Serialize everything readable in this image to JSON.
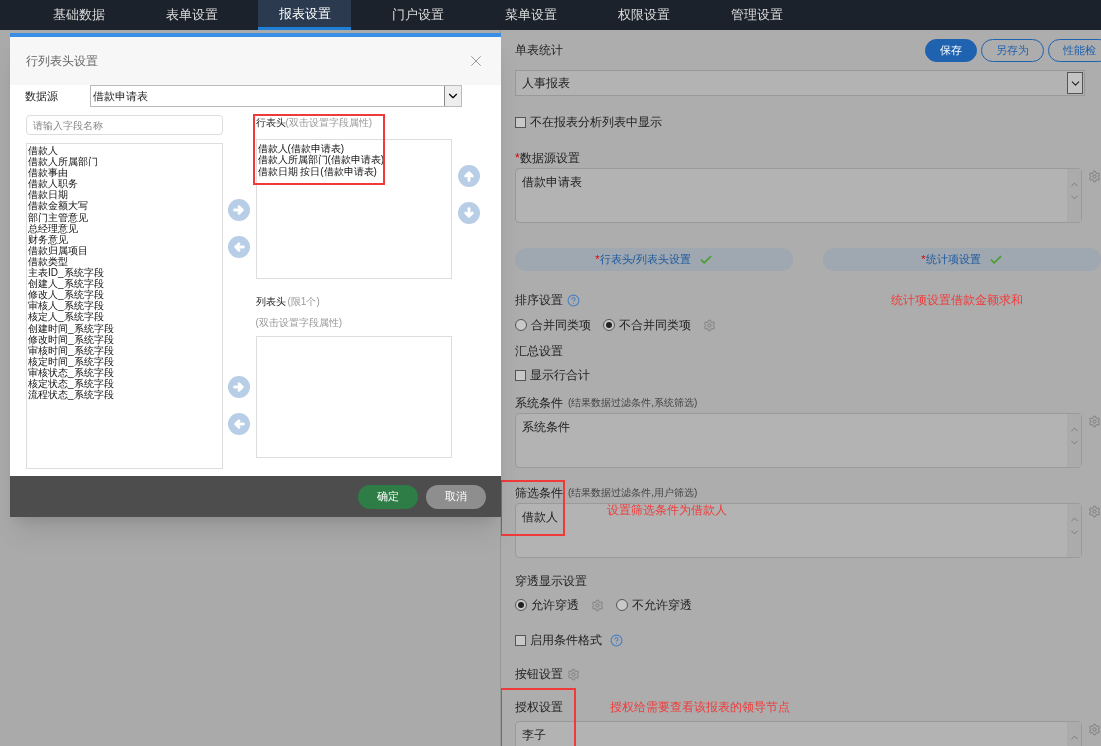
{
  "nav": {
    "tabs": [
      {
        "label": "基础数据",
        "selected": false
      },
      {
        "label": "表单设置",
        "selected": false
      },
      {
        "label": "报表设置",
        "selected": true
      },
      {
        "label": "门户设置",
        "selected": false
      },
      {
        "label": "菜单设置",
        "selected": false
      },
      {
        "label": "权限设置",
        "selected": false
      },
      {
        "label": "管理设置",
        "selected": false
      }
    ]
  },
  "dialog": {
    "title": "行列表头设置",
    "datasource": {
      "label": "数据源",
      "value": "借款申请表"
    },
    "search": {
      "placeholder": "请输入字段名称"
    },
    "fields": [
      "借款人",
      "借款人所属部门",
      "借款事由",
      "借款人职务",
      "借款日期",
      "借款金额大写",
      "部门主管意见",
      "总经理意见",
      "财务意见",
      "借款归属项目",
      "借款类型",
      "主表ID_系统字段",
      "创建人_系统字段",
      "修改人_系统字段",
      "审核人_系统字段",
      "核定人_系统字段",
      "创建时间_系统字段",
      "修改时间_系统字段",
      "审核时间_系统字段",
      "核定时间_系统字段",
      "审核状态_系统字段",
      "核定状态_系统字段",
      "流程状态_系统字段"
    ],
    "row_header": {
      "label": "行表头",
      "hint": "(双击设置字段属性)",
      "items": [
        "借款人(借款申请表)",
        "借款人所属部门(借款申请表)",
        "借款日期 按日(借款申请表)"
      ]
    },
    "column_header": {
      "label": "列表头",
      "limit": "(限1个)",
      "hint": "(双击设置字段属性)"
    },
    "confirm": "确定",
    "cancel": "取消"
  },
  "panel": {
    "title": "单表统计",
    "buttons": [
      {
        "label": "保存",
        "kind": "primary"
      },
      {
        "label": "另存为",
        "kind": "outline"
      },
      {
        "label": "性能检",
        "kind": "outline"
      }
    ],
    "report_type": "人事报表",
    "hide_in_list": {
      "label": "不在报表分析列表中显示",
      "checked": false
    },
    "datasource_setting": {
      "label": "数据源设置",
      "required_mark": "*",
      "value": "借款申请表"
    },
    "setup_buttons": [
      {
        "label": "行表头/列表头设置",
        "required_mark": "*",
        "done": true
      },
      {
        "label": "统计项设置",
        "required_mark": "*",
        "done": true
      }
    ],
    "sort": {
      "label": "排序设置",
      "options": [
        {
          "label": "合并同类项",
          "selected": false
        },
        {
          "label": "不合并同类项",
          "selected": true
        }
      ]
    },
    "summary": {
      "label": "汇总设置",
      "checkbox": {
        "label": "显示行合计",
        "checked": false
      }
    },
    "system_condition": {
      "label": "系统条件",
      "hint": "(结果数据过滤条件,系统筛选)",
      "value": "系统条件"
    },
    "filter_condition": {
      "label": "筛选条件",
      "hint": "(结果数据过滤条件,用户筛选)",
      "value": "借款人"
    },
    "drill": {
      "label": "穿透显示设置",
      "options": [
        {
          "label": "允许穿透",
          "selected": true
        },
        {
          "label": "不允许穿透",
          "selected": false
        }
      ]
    },
    "conditional_format": {
      "label": "启用条件格式",
      "checked": false
    },
    "button_setting": {
      "label": "按钮设置"
    },
    "authorization": {
      "label": "授权设置",
      "value": "李子"
    }
  },
  "annotations": {
    "stat_item": "统计项设置借款金额求和",
    "filter": "设置筛选条件为借款人",
    "authorization": "授权给需要查看该报表的领导节点"
  }
}
